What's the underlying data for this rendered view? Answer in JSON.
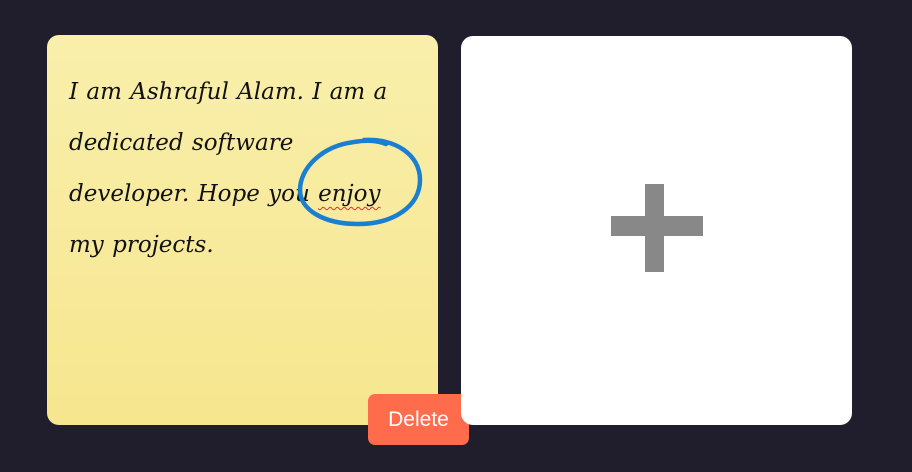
{
  "note": {
    "text_before": "I am Ashraful Alam. I am a dedicated software developer. Hope you ",
    "misspelled_word": "enjoy",
    "text_after": " my projects.",
    "delete_label": "Delete"
  },
  "add_card": {
    "icon": "plus-icon"
  },
  "colors": {
    "background": "#201e2d",
    "note_background": "#f8ea9c",
    "delete_button": "#ff6c4c",
    "annotation_circle": "#1a7fd0",
    "plus_icon": "#888888",
    "spellcheck_underline": "#e0302a"
  }
}
